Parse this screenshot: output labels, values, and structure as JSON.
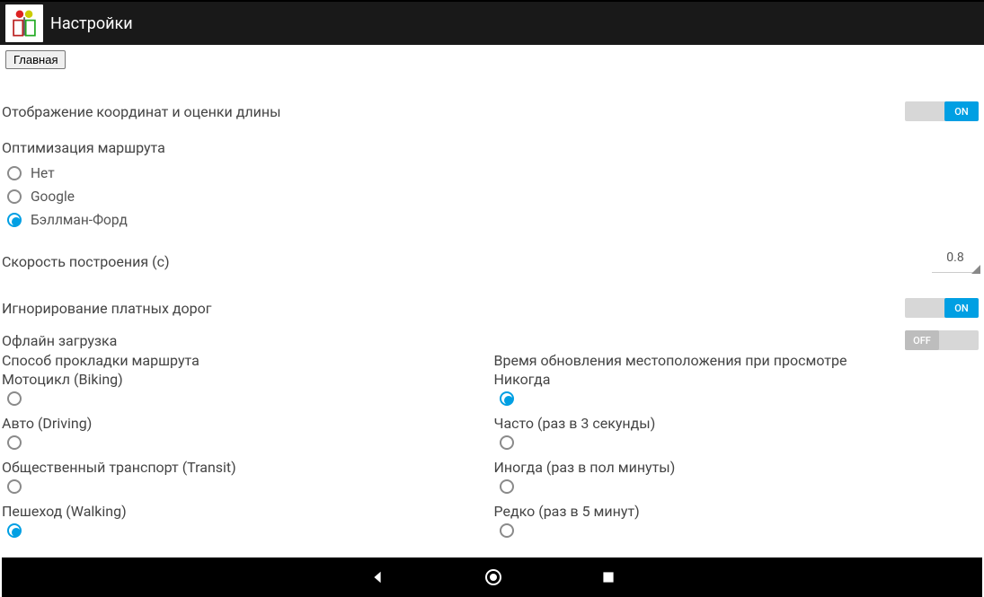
{
  "header": {
    "title": "Настройки"
  },
  "buttons": {
    "home": "Главная"
  },
  "settings": {
    "coords_display": {
      "label": "Отображение координат и оценки длины",
      "value": "ON"
    },
    "route_optimization": {
      "label": "Оптимизация маршрута",
      "options": [
        "Нет",
        "Google",
        "Бэллман-Форд"
      ],
      "selected_index": 2
    },
    "build_speed": {
      "label": "Скорость построения (с)",
      "value": "0.8"
    },
    "ignore_toll": {
      "label": "Игнорирование платных дорог",
      "value": "ON"
    },
    "offline_loading": {
      "label": "Офлайн загрузка",
      "value": "OFF"
    },
    "route_method": {
      "label": "Способ прокладки маршрута",
      "options": [
        "Мотоцикл (Biking)",
        "Авто (Driving)",
        "Общественный транспорт (Transit)",
        "Пешеход (Walking)"
      ],
      "selected_index": 3
    },
    "location_update": {
      "label": "Время обновления местоположения при просмотре",
      "options": [
        "Никогда",
        "Часто (раз в 3 секунды)",
        "Иногда (раз в пол минуты)",
        "Редко (раз в 5 минут)"
      ],
      "selected_index": 0
    }
  },
  "toggle_labels": {
    "on": "ON",
    "off": "OFF"
  }
}
